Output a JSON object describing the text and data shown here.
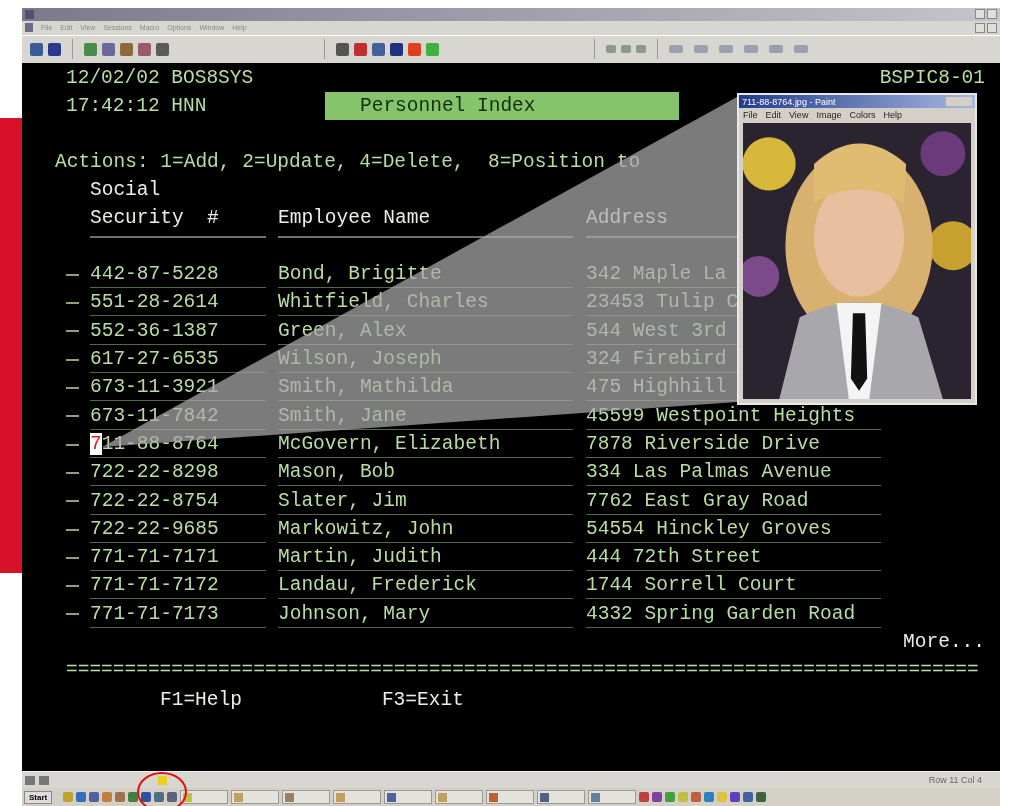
{
  "window": {
    "menu": [
      "File",
      "Edit",
      "View",
      "Sessions",
      "Macro",
      "Options",
      "Window",
      "Help"
    ]
  },
  "terminal": {
    "date_system": "12/02/02 BOS8SYS",
    "time_user": "17:42:12 HNN",
    "screen_title": "Personnel Index",
    "screen_id": "BSPIC8-01",
    "actions": "Actions: 1=Add, 2=Update, 4=Delete,  8=Position to",
    "header_top": "Social",
    "columns": [
      "Security  #",
      "Employee Name",
      "Address"
    ],
    "rows": [
      {
        "ssn": "442-87-5228",
        "name": "Bond, Brigitte",
        "address": "342 Maple La",
        "cursor": false
      },
      {
        "ssn": "551-28-2614",
        "name": "Whitfield, Charles",
        "address": "23453 Tulip C",
        "cursor": false
      },
      {
        "ssn": "552-36-1387",
        "name": "Green, Alex",
        "address": "544 West 3rd",
        "cursor": false
      },
      {
        "ssn": "617-27-6535",
        "name": "Wilson, Joseph",
        "address": "324 Firebird",
        "cursor": false
      },
      {
        "ssn": "673-11-3921",
        "name": "Smith, Mathilda",
        "address": "475 Highhill",
        "cursor": false
      },
      {
        "ssn": "673-11-7842",
        "name": "Smith, Jane",
        "address": "45599 Westpoint Heights",
        "cursor": false
      },
      {
        "ssn": "711-88-8764",
        "name": "McGovern, Elizabeth",
        "address": "7878 Riverside Drive",
        "cursor": true
      },
      {
        "ssn": "722-22-8298",
        "name": "Mason, Bob",
        "address": "334 Las Palmas Avenue",
        "cursor": false
      },
      {
        "ssn": "722-22-8754",
        "name": "Slater, Jim",
        "address": "7762 East Gray Road",
        "cursor": false
      },
      {
        "ssn": "722-22-9685",
        "name": "Markowitz, John",
        "address": "54554 Hinckley Groves",
        "cursor": false
      },
      {
        "ssn": "771-71-7171",
        "name": "Martin, Judith",
        "address": "444 72th Street",
        "cursor": false
      },
      {
        "ssn": "771-71-7172",
        "name": "Landau, Frederick",
        "address": "1744 Sorrell Court",
        "cursor": false
      },
      {
        "ssn": "771-71-7173",
        "name": "Johnson, Mary",
        "address": "4332 Spring Garden Road",
        "cursor": false
      }
    ],
    "more": "More...",
    "separator": "==============================================================================",
    "function_keys": [
      "F1=Help",
      "F3=Exit"
    ]
  },
  "photo_window": {
    "title": "711-88-8764.jpg - Paint",
    "menu": [
      "File",
      "Edit",
      "View",
      "Image",
      "Colors",
      "Help"
    ]
  },
  "status_bar": {
    "position": "Row 11 Col 4"
  },
  "taskbar": {
    "start": "Start"
  }
}
